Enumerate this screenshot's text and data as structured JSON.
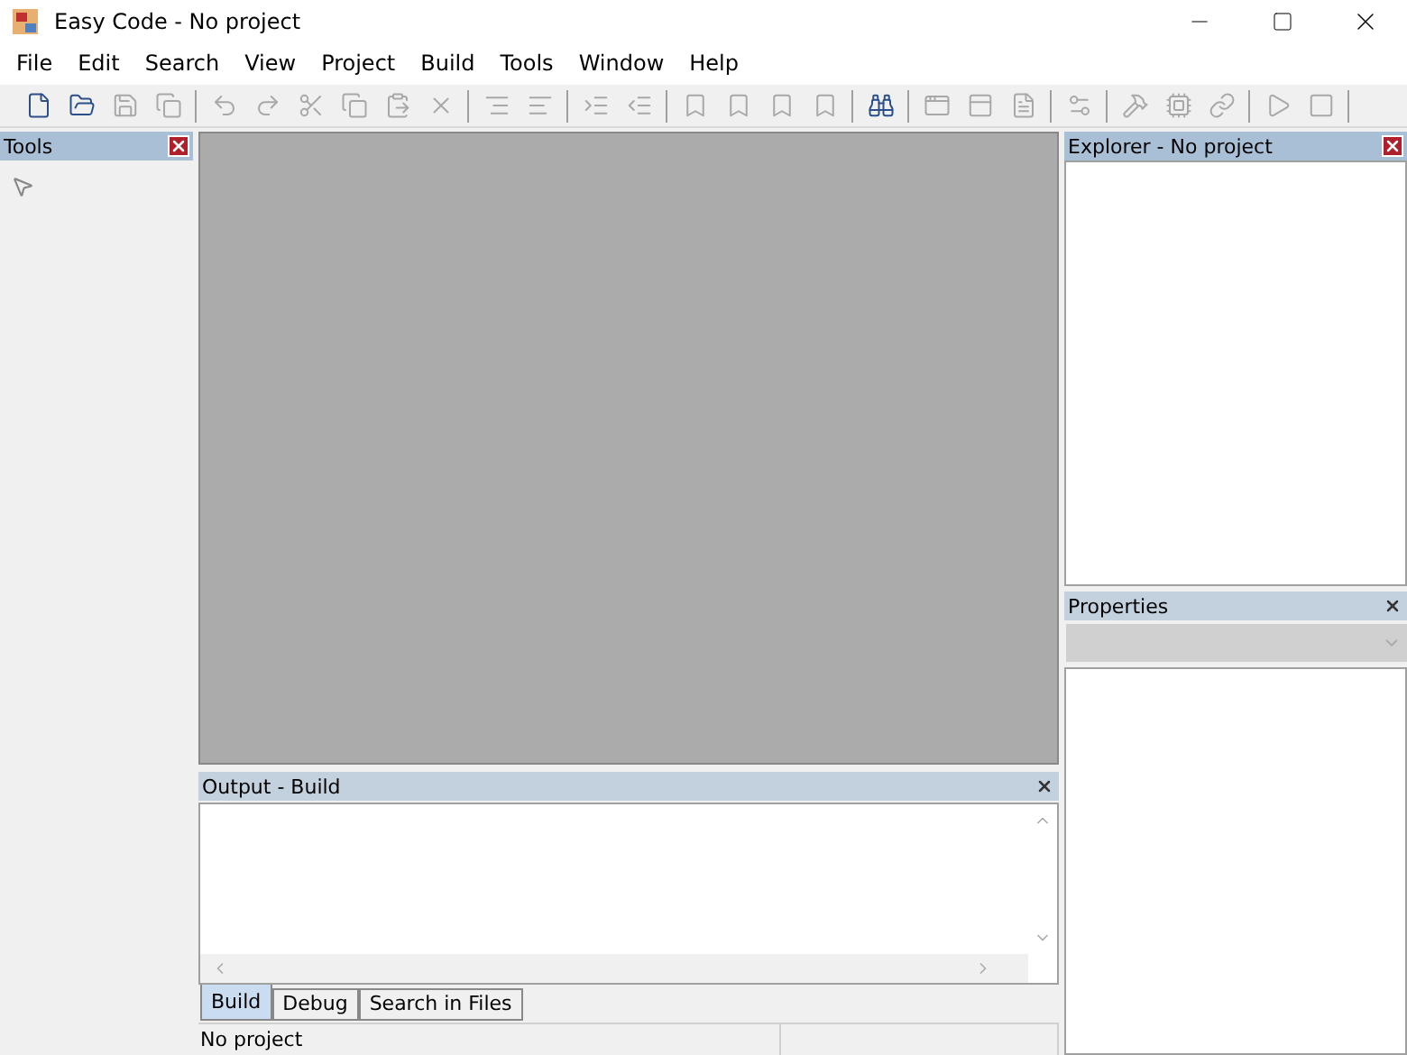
{
  "window": {
    "title": "Easy Code - No project"
  },
  "menu": [
    "File",
    "Edit",
    "Search",
    "View",
    "Project",
    "Build",
    "Tools",
    "Window",
    "Help"
  ],
  "toolbar": [
    [
      {
        "kind": "new",
        "disabled": false
      },
      {
        "kind": "open",
        "disabled": false
      },
      {
        "kind": "save",
        "disabled": true
      },
      {
        "kind": "saveall",
        "disabled": true
      }
    ],
    [
      {
        "kind": "undo",
        "disabled": true
      },
      {
        "kind": "redo",
        "disabled": true
      },
      {
        "kind": "cut",
        "disabled": true
      },
      {
        "kind": "copy",
        "disabled": true
      },
      {
        "kind": "paste",
        "disabled": true
      },
      {
        "kind": "delete",
        "disabled": true
      }
    ],
    [
      {
        "kind": "indent",
        "disabled": true
      },
      {
        "kind": "outdent",
        "disabled": true
      }
    ],
    [
      {
        "kind": "comment",
        "disabled": true
      },
      {
        "kind": "uncomment",
        "disabled": true
      }
    ],
    [
      {
        "kind": "bookmark",
        "disabled": true
      },
      {
        "kind": "bookmark",
        "disabled": true
      },
      {
        "kind": "bookmark",
        "disabled": true
      },
      {
        "kind": "bookmark",
        "disabled": true
      }
    ],
    [
      {
        "kind": "find",
        "disabled": false
      }
    ],
    [
      {
        "kind": "window",
        "disabled": true
      },
      {
        "kind": "panel",
        "disabled": true
      },
      {
        "kind": "document",
        "disabled": true
      }
    ],
    [
      {
        "kind": "properties",
        "disabled": true
      }
    ],
    [
      {
        "kind": "build",
        "disabled": true
      },
      {
        "kind": "compile",
        "disabled": true
      },
      {
        "kind": "link",
        "disabled": true
      }
    ],
    [
      {
        "kind": "run",
        "disabled": true
      },
      {
        "kind": "stop",
        "disabled": true
      }
    ]
  ],
  "tools_panel": {
    "title": "Tools",
    "active": true
  },
  "explorer_panel": {
    "title": "Explorer - No project",
    "active": true
  },
  "properties_panel": {
    "title": "Properties",
    "active": false
  },
  "output_panel": {
    "title": "Output - Build",
    "active": false,
    "tabs": [
      {
        "label": "Build",
        "selected": true
      },
      {
        "label": "Debug",
        "selected": false
      },
      {
        "label": "Search in Files",
        "selected": false
      }
    ]
  },
  "status_bar": [
    "No project"
  ]
}
